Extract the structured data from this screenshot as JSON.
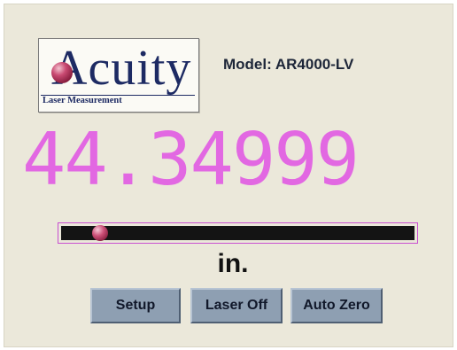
{
  "header": {
    "logo_word": "Acuity",
    "logo_tagline": "Laser Measurement",
    "model_label": "Model:  AR4000-LV"
  },
  "measurement": {
    "value": "44.34999",
    "unit": "in."
  },
  "range_bar": {
    "indicator_fraction": 0.11
  },
  "buttons": {
    "setup": "Setup",
    "laser_off": "Laser Off",
    "auto_zero": "Auto Zero"
  },
  "colors": {
    "reading": "#e268e2",
    "bar_frame": "#c84fd0",
    "bar_track": "#141414",
    "button_face": "#8e9fb2",
    "background": "#ebe8da"
  }
}
